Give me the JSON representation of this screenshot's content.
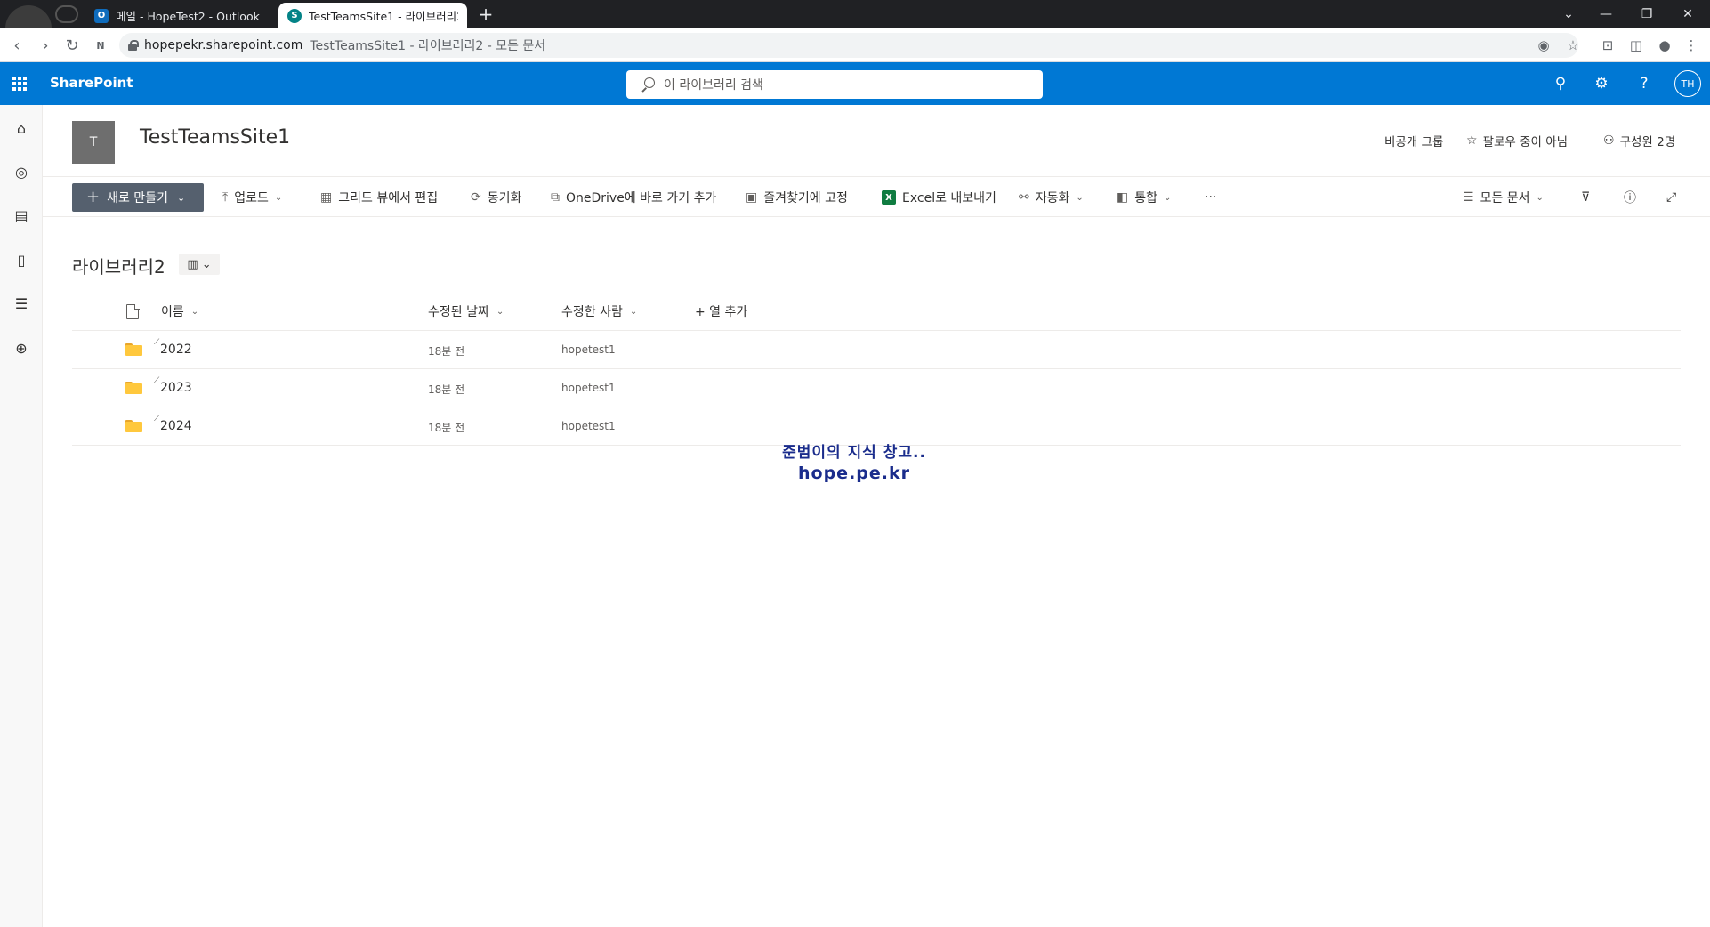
{
  "browser": {
    "tabs": [
      {
        "title": "메일 - HopeTest2 - Outlook",
        "icon": "outlook-icon"
      },
      {
        "title": "TestTeamsSite1 - 라이브러리2 -",
        "icon": "sharepoint-icon"
      }
    ],
    "new_tab": "+",
    "url_host": "hopepekr.sharepoint.com",
    "url_title": "TestTeamsSite1 - 라이브러리2 - 모든 문서"
  },
  "suite": {
    "brand": "SharePoint",
    "search_placeholder": "이 라이브러리 검색",
    "avatar_initials": "TH",
    "colors": {
      "bar": "#0078d4"
    }
  },
  "site": {
    "logo_letter": "T",
    "title": "TestTeamsSite1",
    "privacy": "비공개 그룹",
    "follow": "팔로우 중이 아님",
    "members": "구성원 2명"
  },
  "commands": {
    "new": "새로 만들기",
    "upload": "업로드",
    "grid_edit": "그리드 뷰에서 편집",
    "sync": "동기화",
    "onedrive_shortcut": "OneDrive에 바로 가기 추가",
    "pin_quick": "즐겨찾기에 고정",
    "export_excel": "Excel로 내보내기",
    "automate": "자동화",
    "integrate": "통합",
    "more": "···",
    "view": "모든 문서"
  },
  "library": {
    "title": "라이브러리2",
    "columns": {
      "name": "이름",
      "modified": "수정된 날짜",
      "modified_by": "수정한 사람",
      "add_column": "+ 열 추가"
    },
    "rows": [
      {
        "name": "2022",
        "modified": "18분 전",
        "modified_by": "hopetest1"
      },
      {
        "name": "2023",
        "modified": "18분 전",
        "modified_by": "hopetest1"
      },
      {
        "name": "2024",
        "modified": "18분 전",
        "modified_by": "hopetest1"
      }
    ]
  },
  "watermark": {
    "line1": "준범이의 지식 창고..",
    "line2": "hope.pe.kr"
  }
}
